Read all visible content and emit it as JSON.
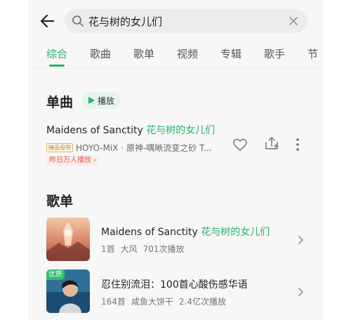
{
  "search": {
    "query": "花与树的女儿们",
    "placeholder": ""
  },
  "tabs": [
    {
      "label": "综合",
      "active": true
    },
    {
      "label": "歌曲"
    },
    {
      "label": "歌单"
    },
    {
      "label": "视频"
    },
    {
      "label": "专辑"
    },
    {
      "label": "歌手"
    },
    {
      "label": "节"
    }
  ],
  "songs_section": {
    "title": "单曲",
    "play_label": "播放",
    "song": {
      "title_en": "Maidens of Sanctity ",
      "title_cn": "花与树的女儿们",
      "quality_badge": "臻品母带",
      "artist_line": "HOYO-MiX · 原神-喁晰流变之砂 T...",
      "rank_tag": "昨日万人播放 ›"
    }
  },
  "playlists_section": {
    "title": "歌单",
    "items": [
      {
        "title_en": "Maidens of Sanctity ",
        "title_cn": "花与树的女儿们",
        "count": "1首",
        "author": "大风",
        "plays": "701次播放"
      },
      {
        "corner_badge": "优质",
        "title": "忍住别流泪：100首心酸伤感华语",
        "count": "164首",
        "author": "咸鱼大饼干",
        "plays": "2.4亿次播放"
      }
    ]
  },
  "colors": {
    "accent": "#22b36b",
    "background": "#f7f7f7",
    "rank_tag": "#e0604a"
  },
  "icons": [
    "back-arrow-icon",
    "search-icon",
    "clear-icon",
    "play-icon",
    "heart-icon",
    "download-icon",
    "more-icon",
    "chevron-right-icon"
  ]
}
